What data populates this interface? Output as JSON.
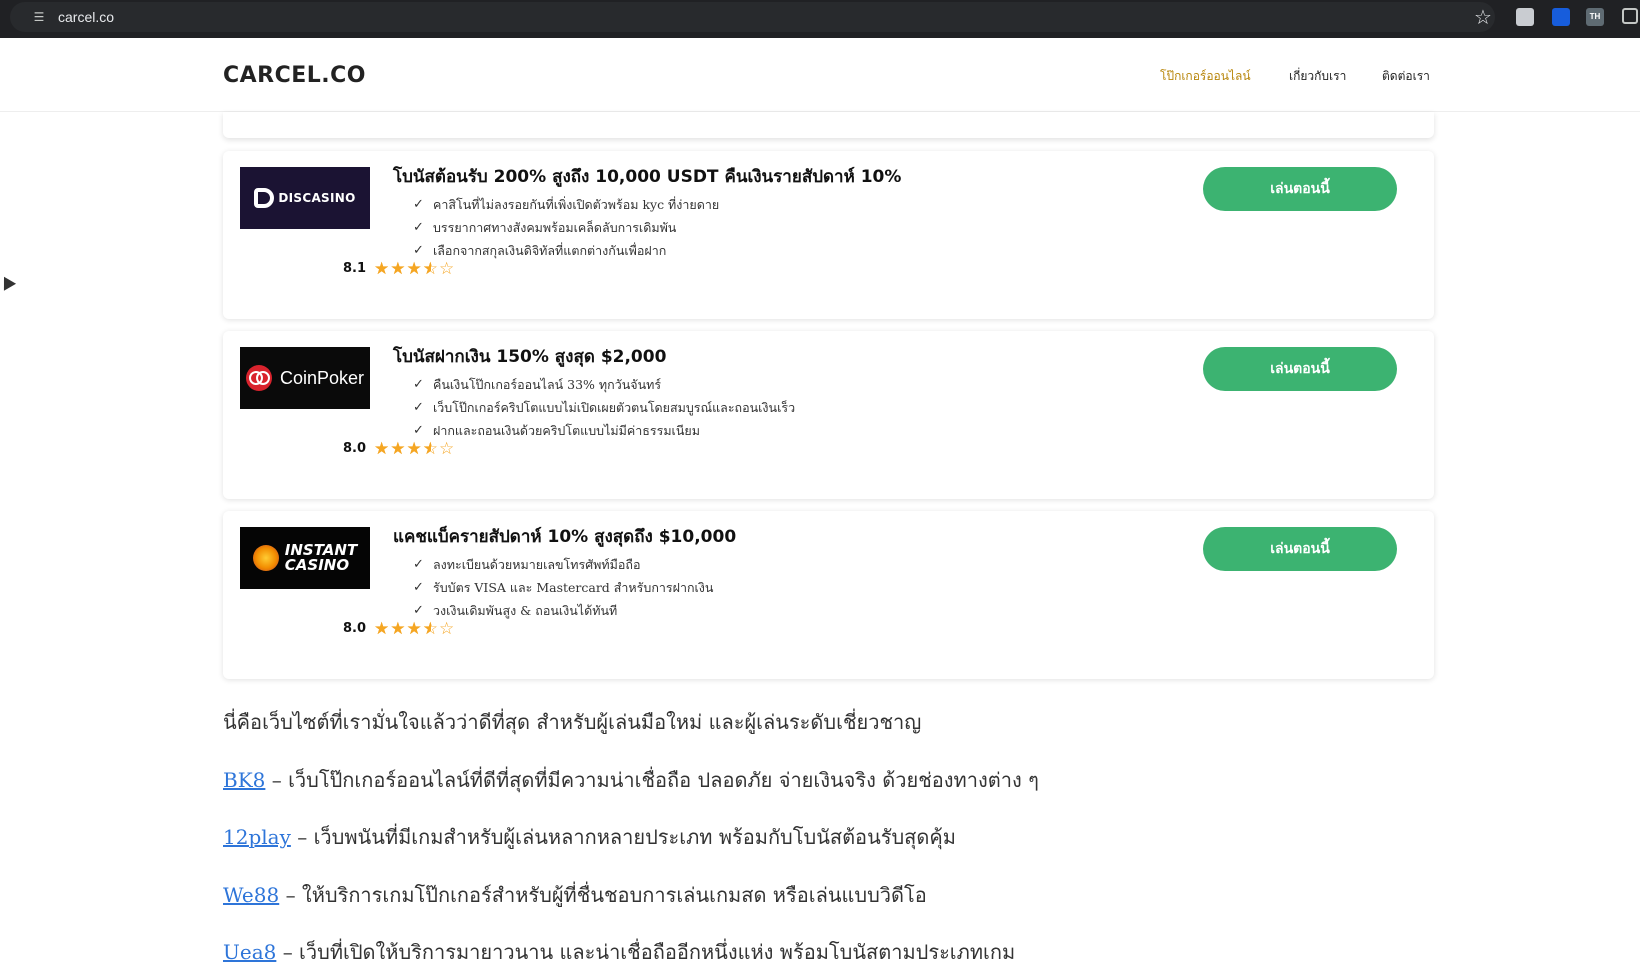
{
  "browser": {
    "url": "carcel.co",
    "extensions": [
      "",
      "",
      "TH",
      ""
    ]
  },
  "header": {
    "logo": "CARCEL.CO",
    "nav": [
      {
        "label": "โป๊กเกอร์ออนไลน์"
      },
      {
        "label": "เกี่ยวกับเรา"
      },
      {
        "label": "ติดต่อเรา"
      }
    ],
    "accent_color": "#b8860b"
  },
  "cards": [
    {
      "brand": "DISCASINO",
      "logo_bg": "#1b1333",
      "title": "โบนัสต้อนรับ 200% สูงถึง 10,000 USDT คืนเงินรายสัปดาห์ 10%",
      "features": [
        "คาสิโนที่ไม่ลงรอยกันที่เพิ่งเปิดตัวพร้อม kyc ที่ง่ายดาย",
        "บรรยากาศทางสังคมพร้อมเคล็ดลับการเดิมพัน",
        "เลือกจากสกุลเงินดิจิทัลที่แตกต่างกันเพื่อฝาก"
      ],
      "rating": "8.1",
      "stars": 3.5,
      "button": "เล่นตอนนี้"
    },
    {
      "brand": "CoinPoker",
      "logo_bg": "#0a0a0a",
      "title": "โบนัสฝากเงิน 150% สูงสุด $2,000",
      "features": [
        "คืนเงินโป๊กเกอร์ออนไลน์ 33% ทุกวันจันทร์",
        "เว็บโป๊กเกอร์คริปโตแบบไม่เปิดเผยตัวตนโดยสมบูรณ์และถอนเงินเร็ว",
        "ฝากและถอนเงินด้วยคริปโตแบบไม่มีค่าธรรมเนียม"
      ],
      "rating": "8.0",
      "stars": 3.5,
      "button": "เล่นตอนนี้"
    },
    {
      "brand_line1": "INSTANT",
      "brand_line2": "CASINO",
      "logo_bg": "#050505",
      "title": "แคชแบ็ครายสัปดาห์ 10% สูงสุดถึง $10,000",
      "features": [
        "ลงทะเบียนด้วยหมายเลขโทรศัพท์มือถือ",
        "รับบัตร VISA และ Mastercard สำหรับการฝากเงิน",
        "วงเงินเดิมพันสูง & ถอนเงินได้ทันที"
      ],
      "rating": "8.0",
      "stars": 3.5,
      "button": "เล่นตอนนี้"
    }
  ],
  "button_color": "#3cb371",
  "star_color": "#f5a623",
  "article": {
    "intro": "นี่คือเว็บไซต์ที่เรามั่นใจแล้วว่าดีที่สุด สำหรับผู้เล่นมือใหม่ และผู้เล่นระดับเชี่ยวชาญ",
    "sites": [
      {
        "name": "BK8",
        "desc": " – เว็บโป๊กเกอร์ออนไลน์ที่ดีที่สุดที่มีความน่าเชื่อถือ ปลอดภัย จ่ายเงินจริง ด้วยช่องทางต่าง ๆ"
      },
      {
        "name": "12play",
        "desc": " – เว็บพนันที่มีเกมสำหรับผู้เล่นหลากหลายประเภท พร้อมกับโบนัสต้อนรับสุดคุ้ม"
      },
      {
        "name": "We88",
        "desc": " – ให้บริการเกมโป๊กเกอร์สำหรับผู้ที่ชื่นชอบการเล่นเกมสด หรือเล่นแบบวิดีโอ"
      },
      {
        "name": "Uea8",
        "desc": " – เว็บที่เปิดให้บริการมายาวนาน และน่าเชื่อถืออีกหนึ่งแห่ง พร้อมโบนัสตามประเภทเกม"
      }
    ],
    "link_color": "#2e75d9"
  }
}
